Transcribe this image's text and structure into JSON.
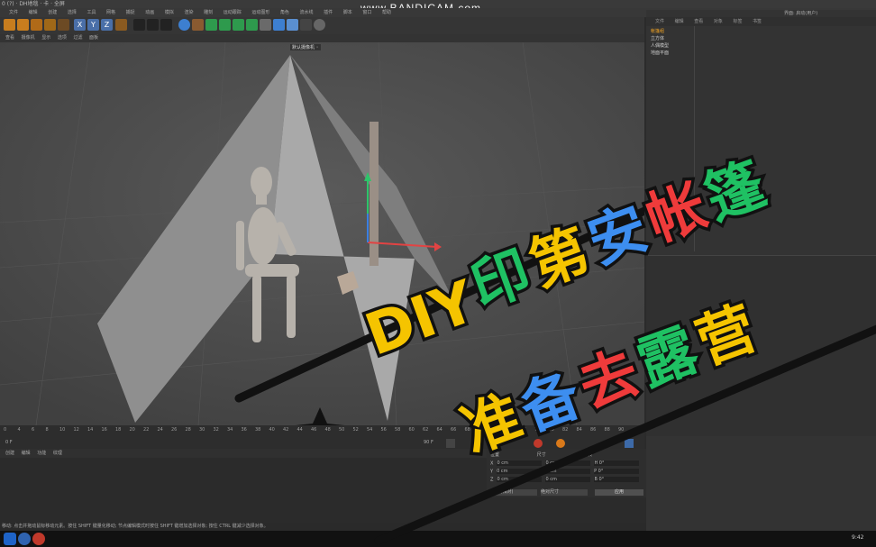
{
  "window": {
    "title": "0 (?) · DH地毯 · 卡 · 全屏"
  },
  "watermark": "www.BANDICAM.com",
  "menubar": {
    "items": [
      "文件",
      "编辑",
      "创建",
      "选择",
      "工具",
      "网格",
      "捕捉",
      "动画",
      "模拟",
      "渲染",
      "雕刻",
      "运动跟踪",
      "运动图形",
      "角色",
      "流水线",
      "插件",
      "脚本",
      "窗口",
      "帮助"
    ]
  },
  "toolbar": {
    "xyz": [
      "X",
      "Y",
      "Z"
    ]
  },
  "viewport": {
    "menu": [
      "查看",
      "摄像机",
      "显示",
      "选项",
      "过滤",
      "面板"
    ],
    "camera_label": "默认摄像机 ◦"
  },
  "right_panel": {
    "tabs": [
      "文件",
      "编辑",
      "查看",
      "对象",
      "标签",
      "书签"
    ],
    "objects": [
      "帐篷组",
      "立方体",
      "人偶模型",
      "地面平面"
    ],
    "top_right_label": "界面: 启动(用户)"
  },
  "timeline": {
    "ticks": [
      "0",
      "4",
      "6",
      "8",
      "10",
      "12",
      "14",
      "16",
      "18",
      "20",
      "22",
      "24",
      "26",
      "28",
      "30",
      "32",
      "34",
      "36",
      "38",
      "40",
      "42",
      "44",
      "46",
      "48",
      "50",
      "52",
      "54",
      "56",
      "58",
      "60",
      "62",
      "64",
      "66",
      "68",
      "70",
      "72",
      "74",
      "76",
      "78",
      "80",
      "82",
      "84",
      "86",
      "88",
      "90"
    ],
    "frame_start": "0 F",
    "frame_end": "90 F"
  },
  "material_bar": {
    "items": [
      "创建",
      "编辑",
      "功能",
      "纹理"
    ]
  },
  "coords": {
    "header": [
      "位置",
      "尺寸",
      "旋转"
    ],
    "rows": [
      {
        "axis": "X",
        "pos": "0 cm",
        "size": "0 cm",
        "rot": "H 0°"
      },
      {
        "axis": "Y",
        "pos": "0 cm",
        "size": "0 cm",
        "rot": "P 0°"
      },
      {
        "axis": "Z",
        "pos": "0 cm",
        "size": "0 cm",
        "rot": "B 0°"
      }
    ],
    "mode_a": "对象 (相对)",
    "mode_b": "绝对尺寸",
    "apply": "应用"
  },
  "statusbar": "移动: 点击并拖动鼠标移动元素。按住 SHIFT 键量化移动; 节点编辑模式时按住 SHIFT 键增加选择对象; 按住 CTRL 键减少选择对象。",
  "overlay": {
    "line1": [
      "DIY",
      "印",
      "第",
      "安",
      "帐",
      "篷"
    ],
    "line2": [
      "准",
      "备",
      "去",
      "露",
      "营"
    ]
  },
  "colors": {
    "blue": "#3d8ef0",
    "green": "#1fc163",
    "yellow": "#f5c400",
    "red": "#ef3b3b",
    "orange": "#f0a21b"
  },
  "taskbar": {
    "clock": "9:42"
  }
}
